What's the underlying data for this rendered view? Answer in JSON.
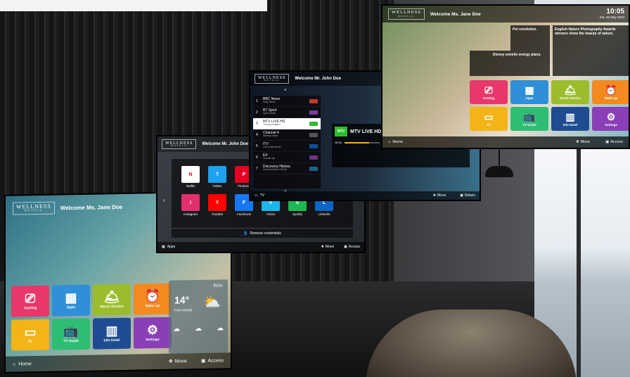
{
  "tv1": {
    "brand": "WELLNESS",
    "brand_sub": "HOTELS",
    "welcome": "Welcome Ms. Jane Doe",
    "tiles": [
      {
        "label": "Casting",
        "icon": "cast-icon",
        "color": "#e8376b"
      },
      {
        "label": "Apps",
        "icon": "apps-grid-icon",
        "color": "#2f8fd8"
      },
      {
        "label": "Room Service",
        "icon": "room-service-icon",
        "color": "#9bbd2d"
      },
      {
        "label": "Wake up",
        "icon": "alarm-clock-icon",
        "color": "#f38a1f"
      },
      {
        "label": "TV",
        "icon": "tv-icon",
        "color": "#f2b417"
      },
      {
        "label": "TV Guide",
        "icon": "tv-guide-icon",
        "color": "#2dbd73"
      },
      {
        "label": "Info Hotel",
        "icon": "hotel-icon",
        "color": "#1f4c91"
      },
      {
        "label": "Settings",
        "icon": "gear-icon",
        "color": "#8a3fb6"
      }
    ],
    "weather": {
      "city": "Ibiza",
      "temp": "14°",
      "desc": "Few clouds"
    },
    "footer": {
      "home": "Home",
      "move": "Move",
      "access": "Access"
    }
  },
  "tv2": {
    "brand": "WELLNESS",
    "brand_sub": "HOTELS",
    "welcome": "Welcome Mr. John Doe",
    "apps_row1": [
      "Netflix",
      "Twitter",
      "Pinterest"
    ],
    "apps_row2": [
      "Instagram",
      "Youtube",
      "Facebook",
      "Vimeo",
      "Spotify",
      "LinkedIn"
    ],
    "remove": "Remove credentials",
    "footer": {
      "apps": "Apps",
      "move": "Move",
      "access": "Access"
    }
  },
  "tv3": {
    "brand": "WELLNESS",
    "brand_sub": "HOTELS",
    "welcome": "Welcome Mr. John Doe",
    "channels": [
      {
        "num": "1",
        "name": "BBC News",
        "sub": "Daily News"
      },
      {
        "num": "2",
        "name": "BT Sport",
        "sub": "Sport News"
      },
      {
        "num": "3",
        "name": "MTV LIVE HD",
        "sub": "Young prodigies"
      },
      {
        "num": "4",
        "name": "Channel 4",
        "sub": "Weekly News"
      },
      {
        "num": "5",
        "name": "ITV",
        "sub": "Out of this world"
      },
      {
        "num": "6",
        "name": "E4",
        "sub": "Cornell rap"
      },
      {
        "num": "7",
        "name": "Discovery History",
        "sub": "Ancient Aztec's World"
      }
    ],
    "now": {
      "title": "MTV LIVE HD",
      "time": "16:00"
    },
    "footer": {
      "tv": "TV",
      "move": "Move",
      "return": "Return"
    }
  },
  "tv4": {
    "brand": "WELLNESS",
    "brand_sub": "HOTELS",
    "welcome": "Welcome Ms. Jane Doe",
    "time": "10:05",
    "date": "Sat, 20 May 2023",
    "news": [
      {
        "title": "Pet revolution."
      },
      {
        "title": "Disney unveils energy plans."
      },
      {
        "title": "English Nature Photography Awards winners show the beauty of nature."
      }
    ],
    "tiles": [
      {
        "label": "Casting",
        "icon": "cast-icon",
        "color": "#e8376b"
      },
      {
        "label": "Apps",
        "icon": "apps-grid-icon",
        "color": "#2f8fd8"
      },
      {
        "label": "Room Service",
        "icon": "room-service-icon",
        "color": "#9bbd2d"
      },
      {
        "label": "Wake up",
        "icon": "alarm-clock-icon",
        "color": "#f38a1f"
      },
      {
        "label": "TV",
        "icon": "tv-icon",
        "color": "#f2b417"
      },
      {
        "label": "TV Guide",
        "icon": "tv-guide-icon",
        "color": "#2dbd73"
      },
      {
        "label": "Info Hotel",
        "icon": "hotel-icon",
        "color": "#1f4c91"
      },
      {
        "label": "Settings",
        "icon": "gear-icon",
        "color": "#8a3fb6"
      }
    ],
    "footer": {
      "home": "Home",
      "move": "Move",
      "access": "Access"
    }
  }
}
